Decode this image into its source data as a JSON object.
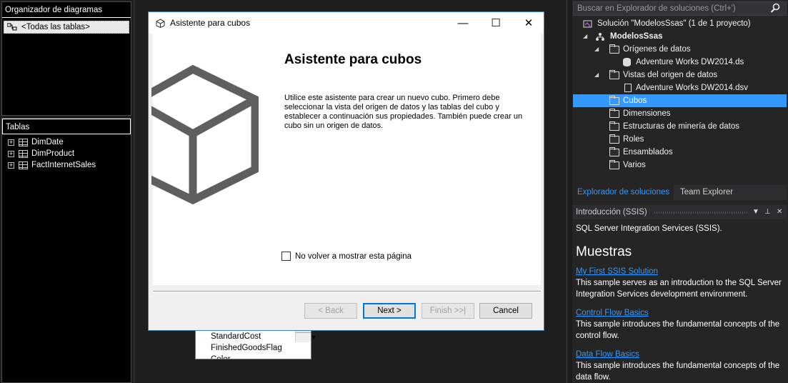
{
  "left": {
    "diagram_organizer_title": "Organizador de diagramas",
    "all_tables_label": "<Todas las tablas>",
    "tables_title": "Tablas",
    "tables": [
      "DimDate",
      "DimProduct",
      "FactInternetSales"
    ]
  },
  "designer": {
    "columns": [
      "StandardCost",
      "FinishedGoodsFlag",
      "Color"
    ]
  },
  "dialog": {
    "title": "Asistente para cubos",
    "heading": "Asistente para cubos",
    "description": "Utilice este asistente para crear un nuevo cubo. Primero debe seleccionar la vista del origen de datos y las tablas del cubo y establecer a continuación sus propiedades. También puede crear un cubo sin un origen de datos.",
    "checkbox_label": "No volver a mostrar esta página",
    "buttons": {
      "back": "< Back",
      "next": "Next >",
      "finish": "Finish >>|",
      "cancel": "Cancel"
    }
  },
  "solution_explorer": {
    "search_placeholder": "Buscar en Explorador de soluciones (Ctrl+')",
    "solution": "Solución \"ModelosSsas\" (1 de 1 proyecto)",
    "project": "ModelosSsas",
    "data_sources": "Orígenes de datos",
    "data_source_item": "Adventure Works DW2014.ds",
    "data_source_views": "Vistas del origen de datos",
    "data_source_view_item": "Adventure Works DW2014.dsv",
    "cubes": "Cubos",
    "dimensions": "Dimensiones",
    "mining": "Estructuras de minería de datos",
    "roles": "Roles",
    "assemblies": "Ensamblados",
    "misc": "Varios",
    "tab_solution": "Explorador de soluciones",
    "tab_team": "Team Explorer"
  },
  "intro": {
    "header": "Introducción (SSIS)",
    "subtitle": "SQL Server Integration Services (SSIS).",
    "heading": "Muestras",
    "samples": [
      {
        "link": "My First SSIS Solution",
        "text": "This sample serves as an introduction to the SQL Server Integration Services development environment."
      },
      {
        "link": "Control Flow Basics",
        "text": "This sample introduces the fundamental concepts of the control flow."
      },
      {
        "link": "Data Flow Basics",
        "text": "This sample introduces the fundamental concepts of the data flow."
      }
    ]
  }
}
